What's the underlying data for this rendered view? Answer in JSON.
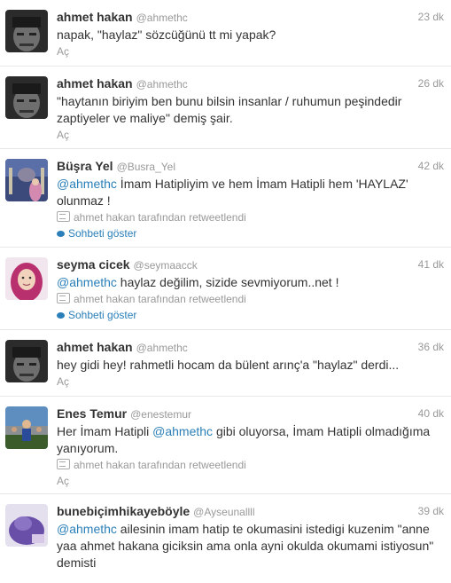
{
  "colors": {
    "link": "#2a7fb8",
    "muted": "#999999",
    "text": "#333333"
  },
  "tweets": [
    {
      "name": "ahmet hakan",
      "handle": "@ahmethc",
      "time": "23 dk",
      "text": "napak, \"haylaz\" sözcüğünü tt mi yapak?",
      "open": "Aç"
    },
    {
      "name": "ahmet hakan",
      "handle": "@ahmethc",
      "time": "26 dk",
      "text": "\"haytanın biriyim ben bunu bilsin insanlar / ruhumun peşindedir zaptiyeler ve maliye\" demiş şair.",
      "open": "Aç"
    },
    {
      "name": "Büşra Yel",
      "handle": "@Busra_Yel",
      "time": "42 dk",
      "mention": "@ahmethc",
      "text": " İmam Hatipliyim ve hem İmam Hatipli hem 'HAYLAZ' olunmaz !",
      "retweet": "ahmet hakan tarafından retweetlendi",
      "conversation": "Sohbeti göster"
    },
    {
      "name": "seyma cicek",
      "handle": "@seymaacck",
      "time": "41 dk",
      "mention": "@ahmethc",
      "text": " haylaz değilim, sizide sevmiyorum..net !",
      "retweet": "ahmet hakan tarafından retweetlendi",
      "conversation": "Sohbeti göster"
    },
    {
      "name": "ahmet hakan",
      "handle": "@ahmethc",
      "time": "36 dk",
      "text": "hey gidi hey! rahmetli hocam da bülent arınç'a \"haylaz\" derdi...",
      "open": "Aç"
    },
    {
      "name": "Enes Temur",
      "handle": "@enestemur",
      "time": "40 dk",
      "text_before": "Her İmam Hatipli ",
      "mention": "@ahmethc",
      "text": " gibi oluyorsa, İmam Hatipli olmadığıma yanıyorum.",
      "retweet": "ahmet hakan tarafından retweetlendi",
      "open": "Aç"
    },
    {
      "name": "bunebiçimhikayeböyle",
      "handle": "@Ayseunallll",
      "time": "39 dk",
      "mention": "@ahmethc",
      "text": " ailesinin imam hatip te okumasini istedigi kuzenim \"anne yaa ahmet hakana giciksin ama onla ayni okulda okumami istiyosun\" demisti"
    }
  ]
}
